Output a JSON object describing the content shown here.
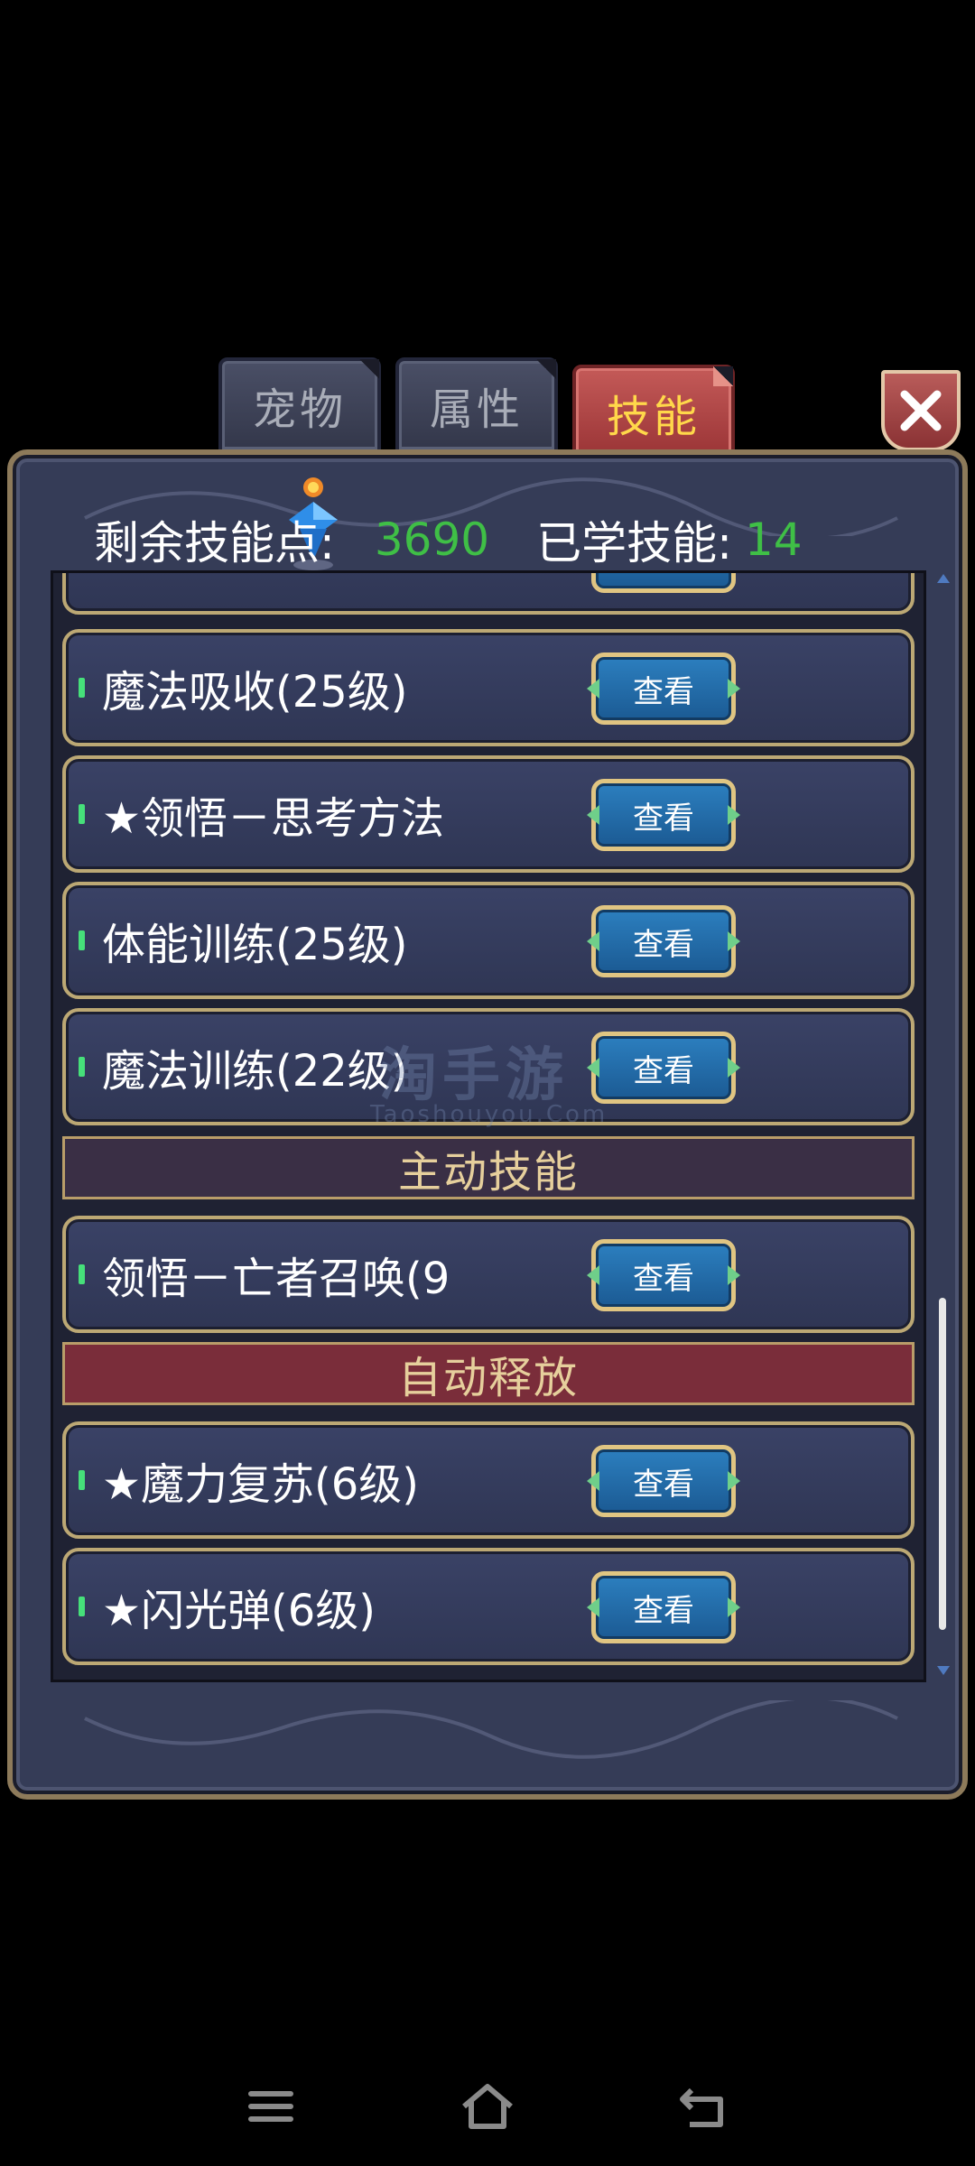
{
  "tabs": [
    {
      "label": "宠物",
      "active": false
    },
    {
      "label": "属性",
      "active": false
    },
    {
      "label": "技能",
      "active": true
    }
  ],
  "header": {
    "remaining_label": "剩余技能点:",
    "remaining_value": "3690",
    "learned_label": "已学技能:",
    "learned_value": "14"
  },
  "view_label": "查看",
  "rows": [
    {
      "label": "魔法吸收(25级)"
    },
    {
      "label": "★领悟－思考方法"
    },
    {
      "label": "体能训练(25级)"
    },
    {
      "label": "魔法训练(22级)"
    },
    {
      "label": "领悟－亡者召唤(9"
    },
    {
      "label": "★魔力复苏(6级)"
    },
    {
      "label": "★闪光弹(6级)"
    }
  ],
  "sections": {
    "active_skills": "主动技能",
    "auto_release": "自动释放"
  },
  "watermark": {
    "main": "淘手游",
    "sub": "Taoshouyou.Com"
  },
  "colors": {
    "accent_green": "#3fbf46",
    "tab_active": "#b4484a",
    "tab_active_text": "#ffd84a",
    "panel_bg": "#353c57",
    "button_blue": "#2c7fbf"
  }
}
